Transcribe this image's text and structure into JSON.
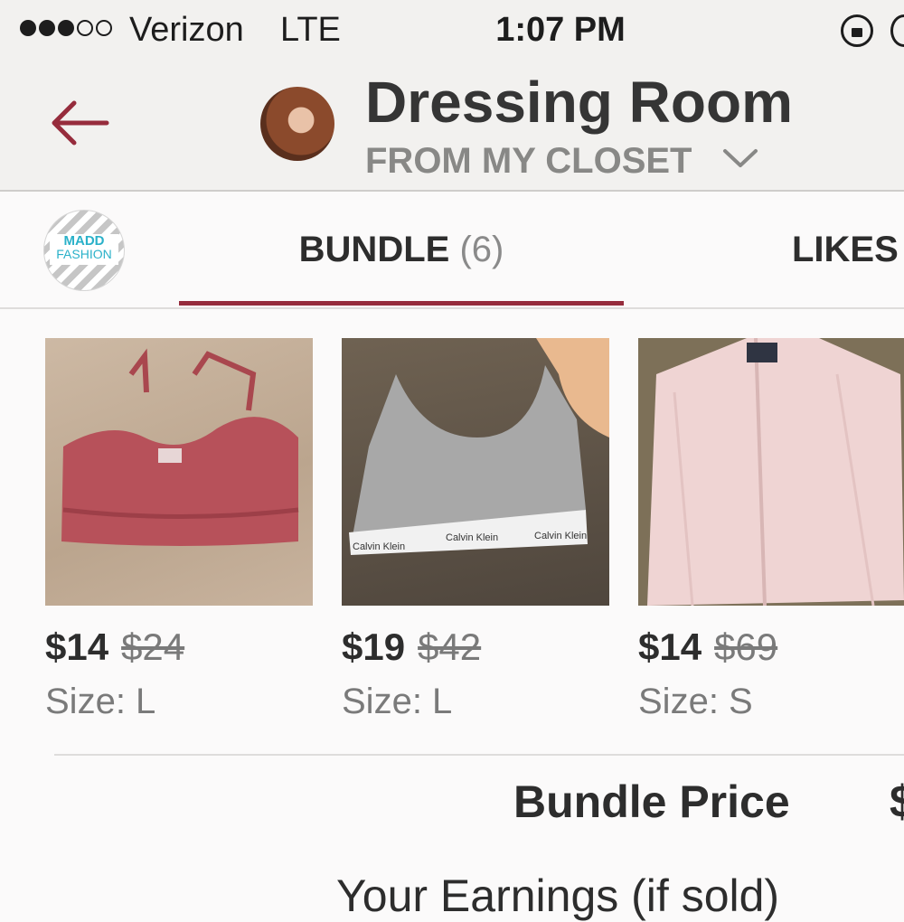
{
  "status_bar": {
    "signal_bars_filled": 3,
    "signal_bars_total": 5,
    "carrier": "Verizon",
    "network": "LTE",
    "time": "1:07 PM",
    "icons": [
      "rotation-lock-icon",
      "battery-icon"
    ]
  },
  "header": {
    "back_icon": "arrow-left-icon",
    "title": "Dressing Room",
    "subtitle": "FROM MY CLOSET",
    "dropdown_icon": "chevron-down-icon"
  },
  "tabs": {
    "logo_line1": "MADD",
    "logo_line2": "FASHION",
    "bundle_label": "BUNDLE",
    "bundle_count": "(6)",
    "likes_label": "LIKES",
    "active": "bundle"
  },
  "items": [
    {
      "price": "$14",
      "original_price": "$24",
      "size": "Size: L",
      "photo": "pink lace bralette"
    },
    {
      "price": "$19",
      "original_price": "$42",
      "size": "Size: L",
      "photo": "gray Calvin Klein sports bra",
      "brand_text": "Calvin Klein"
    },
    {
      "price": "$14",
      "original_price": "$69",
      "size": "Size: S",
      "photo": "pink striped button-up shirt"
    }
  ],
  "summary": {
    "bundle_price_label": "Bundle Price",
    "bundle_price_value": "$",
    "earnings_label": "Your Earnings (if sold)"
  },
  "colors": {
    "accent": "#962c3c",
    "header_bg": "#f2f1ef",
    "page_bg": "#fbfafa",
    "muted_text": "#7a7a7a"
  }
}
